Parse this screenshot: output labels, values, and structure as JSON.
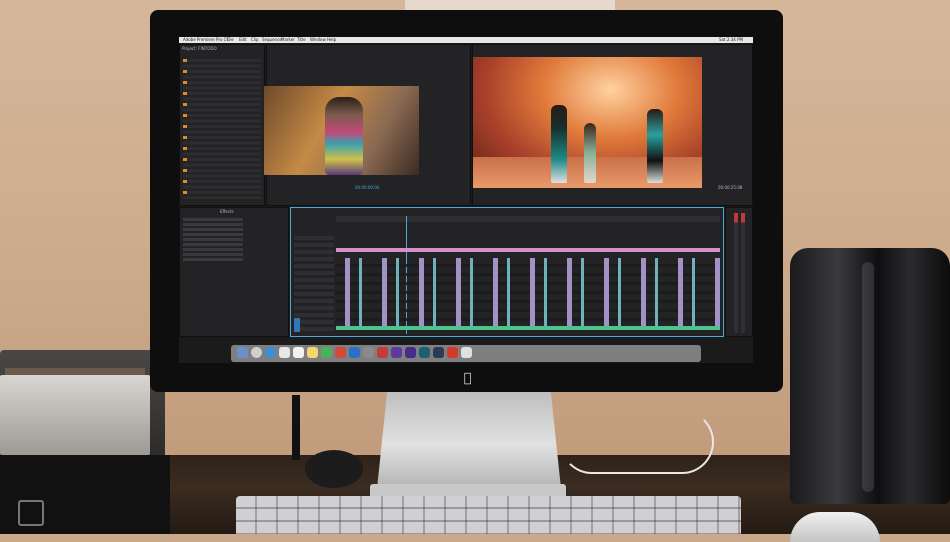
{
  "scene": {
    "description_objects": [
      "monitor",
      "keyboard",
      "printer",
      "mac-pro",
      "webcam",
      "mouse"
    ]
  },
  "screen": {
    "menubar": {
      "app": "Adobe Premiere Pro CC",
      "items": [
        "File",
        "Edit",
        "Clip",
        "Sequence",
        "Marker",
        "Title",
        "Window",
        "Help"
      ],
      "clock": "Sat 2:34 PM"
    },
    "panels": {
      "project_title": "Project: FINTODO",
      "source_timecode": "00:00:00:00",
      "program_timecode": "00:00:25:08",
      "effects_title": "Effects"
    },
    "colors": {
      "timeline_border": "#4aa9d9",
      "audio_pink": "#d68fc7",
      "clip_lavender": "#b7a5e0",
      "clip_cyan": "#7ccbd6",
      "audio_green": "#4ec38a"
    }
  }
}
